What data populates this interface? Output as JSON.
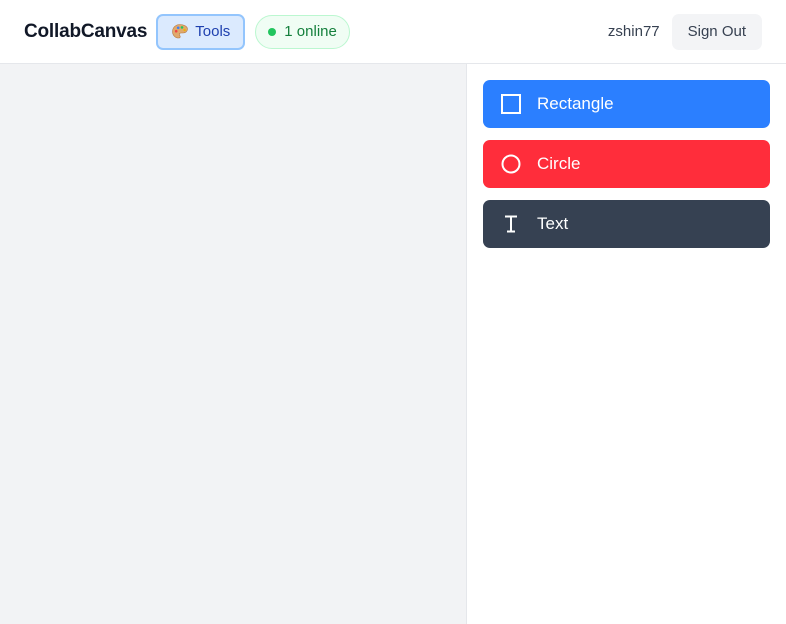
{
  "header": {
    "brand": "CollabCanvas",
    "tools_label": "Tools",
    "online_label": "1 online",
    "username": "zshin77",
    "signout_label": "Sign Out"
  },
  "tools": [
    {
      "label": "Rectangle",
      "icon": "square-icon",
      "color": "#2b7fff"
    },
    {
      "label": "Circle",
      "icon": "circle-icon",
      "color": "#ff2d3b"
    },
    {
      "label": "Text",
      "icon": "text-cursor-icon",
      "color": "#364152"
    }
  ],
  "colors": {
    "accent": "#2b7fff",
    "online": "#22c55e"
  }
}
